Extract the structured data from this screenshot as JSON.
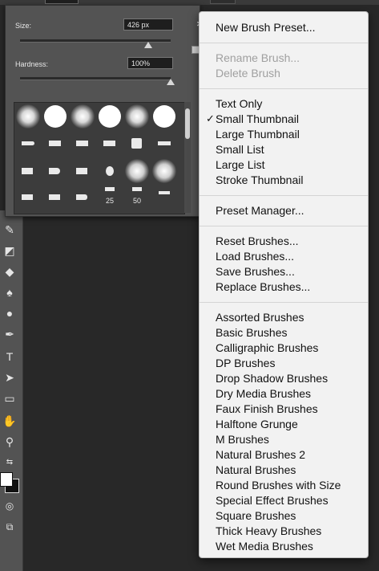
{
  "toolbar": {
    "size_value": "426"
  },
  "panel": {
    "size_label": "Size:",
    "size_value": "426 px",
    "size_slider": 0.85,
    "hardness_label": "Hardness:",
    "hardness_value": "100%",
    "hardness_slider": 1.0,
    "grid_numbers": [
      "25",
      "50"
    ]
  },
  "menu": {
    "groups": [
      [
        "New Brush Preset..."
      ],
      [
        "Rename Brush...",
        "Delete Brush"
      ],
      [
        "Text Only",
        "Small Thumbnail",
        "Large Thumbnail",
        "Small List",
        "Large List",
        "Stroke Thumbnail"
      ],
      [
        "Preset Manager..."
      ],
      [
        "Reset Brushes...",
        "Load Brushes...",
        "Save Brushes...",
        "Replace Brushes..."
      ],
      [
        "Assorted Brushes",
        "Basic Brushes",
        "Calligraphic Brushes",
        "DP Brushes",
        "Drop Shadow Brushes",
        "Dry Media Brushes",
        "Faux Finish Brushes",
        "Halftone Grunge",
        "M Brushes",
        "Natural Brushes 2",
        "Natural Brushes",
        "Round Brushes with Size",
        "Special Effect Brushes",
        "Square Brushes",
        "Thick Heavy Brushes",
        "Wet Media Brushes"
      ]
    ],
    "disabled": [
      "Rename Brush...",
      "Delete Brush"
    ],
    "checked": "Small Thumbnail"
  },
  "colors": {
    "menu_bg": "#f2f2f2",
    "panel_bg": "#535353",
    "canvas_bg": "#282828"
  }
}
